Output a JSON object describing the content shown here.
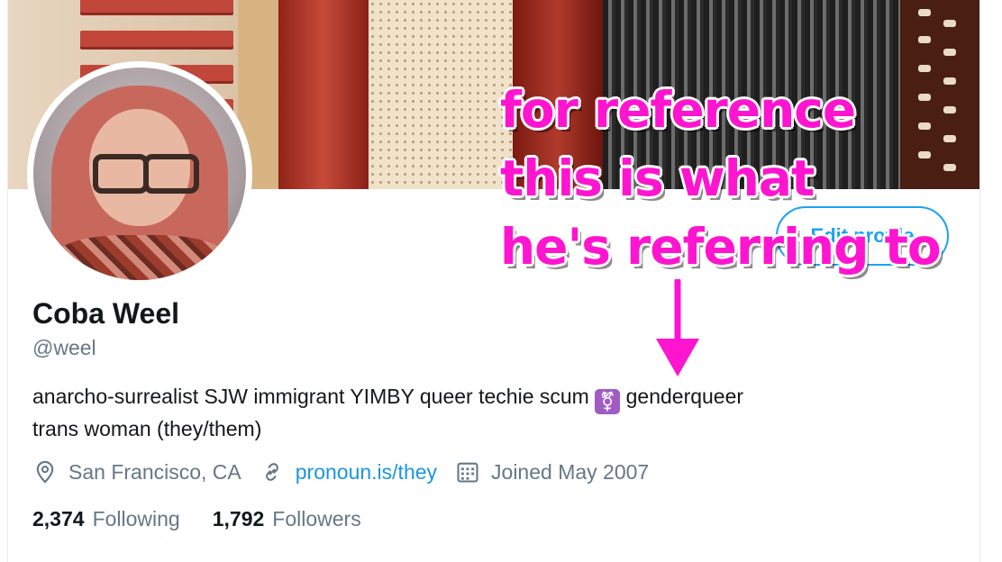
{
  "profile": {
    "display_name": "Coba Weel",
    "handle": "@weel",
    "bio_line1_before": "anarcho-surrealist SJW immigrant YIMBY queer techie scum",
    "bio_emoji": "⚧",
    "bio_line1_after": "genderqueer",
    "bio_line2": "trans woman (they/them)",
    "location": "San Francisco, CA",
    "website": "pronoun.is/they",
    "joined": "Joined May 2007",
    "edit_button": "Edit profile",
    "following_count": "2,374",
    "following_label": "Following",
    "followers_count": "1,792",
    "followers_label": "Followers"
  },
  "overlay": {
    "line1": "for reference",
    "line2": "this is what",
    "line3": "he's referring to"
  },
  "icons": {
    "location": "location-pin-icon",
    "link": "link-icon",
    "calendar": "calendar-icon"
  },
  "colors": {
    "link": "#1b95e0",
    "overlay_text": "#ff14cf",
    "button_border": "#1da1f2"
  }
}
